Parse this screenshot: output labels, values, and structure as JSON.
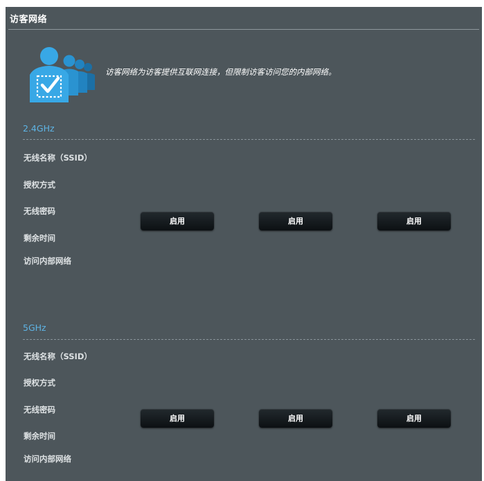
{
  "page": {
    "title": "访客网络",
    "description": "访客网络为访客提供互联网连接，但限制访客访问您的内部网络。",
    "illustration_icon": "guest-users-icon"
  },
  "colors": {
    "panel_bg": "#4d565b",
    "band_title": "#5eb4e5",
    "button_bg": "#12181b",
    "label_text": "#dde1e3"
  },
  "bands": [
    {
      "title": "2.4GHz",
      "row_labels": [
        "无线名称（SSID）",
        "授权方式",
        "无线密码",
        "剩余时间",
        "访问内部网络"
      ],
      "buttons": [
        "启用",
        "启用",
        "启用"
      ]
    },
    {
      "title": "5GHz",
      "row_labels": [
        "无线名称（SSID）",
        "授权方式",
        "无线密码",
        "剩余时间",
        "访问内部网络"
      ],
      "buttons": [
        "启用",
        "启用",
        "启用"
      ]
    }
  ]
}
